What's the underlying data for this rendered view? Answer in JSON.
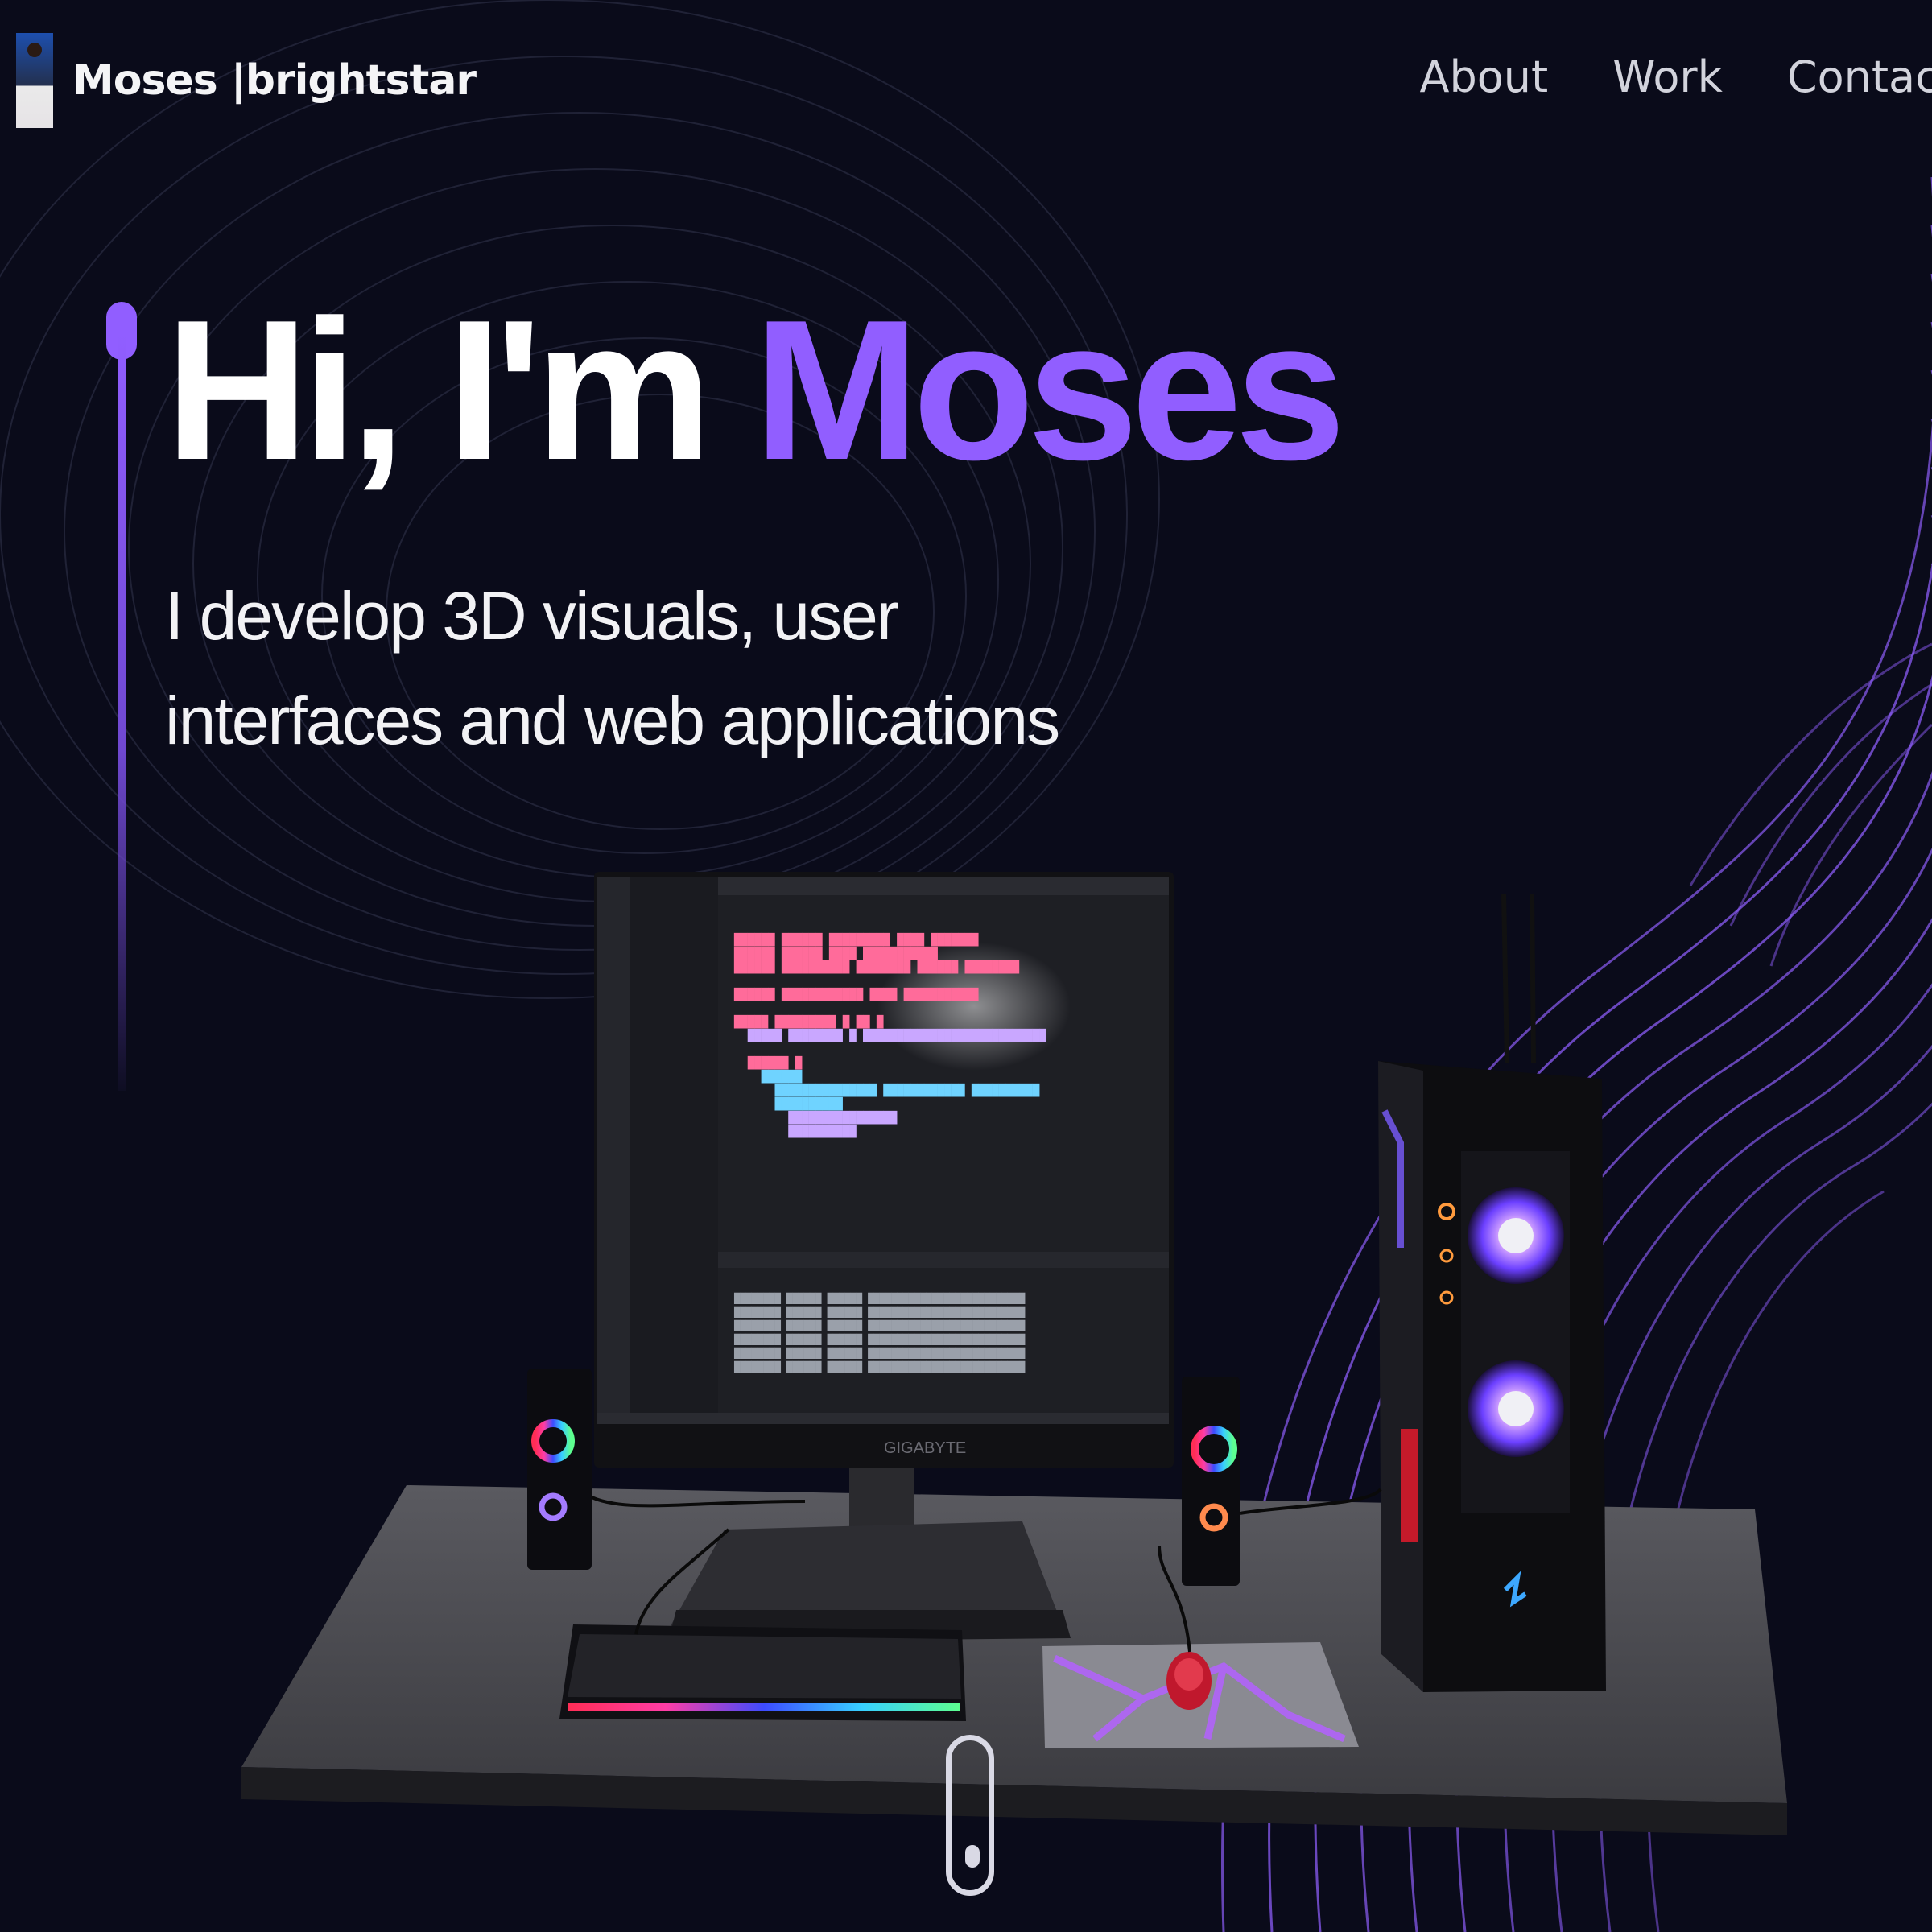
{
  "brand": {
    "name": "Moses |brightstar",
    "logo": "profile-avatar"
  },
  "nav": {
    "links": [
      "About",
      "Work",
      "Contact"
    ]
  },
  "hero": {
    "greeting": "Hi, I'm",
    "name": "Moses",
    "subtitle_line1": "I develop 3D visuals, user",
    "subtitle_line2": "interfaces and web applications"
  },
  "scene": {
    "monitor_brand": "GIGABYTE",
    "objects": [
      "desk",
      "monitor",
      "keyboard",
      "mouse",
      "mousepad",
      "left-speaker",
      "right-speaker",
      "pc-tower"
    ]
  },
  "colors": {
    "accent": "#915eff",
    "background": "#0a0b1a",
    "text": "#ffffff"
  },
  "icons": [
    "scroll-indicator-icon"
  ]
}
